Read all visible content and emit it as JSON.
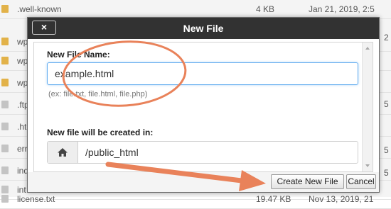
{
  "background_list": {
    "rows": [
      {
        "name": ".well-known",
        "size": "4 KB",
        "date": "Jan 21, 2019, 2:5",
        "icon": "folder-icon"
      },
      {
        "name": "wp",
        "size": "",
        "date": "",
        "icon": "folder-icon"
      },
      {
        "name": "wp",
        "size": "",
        "date": "",
        "icon": "folder-icon"
      },
      {
        "name": "wp",
        "size": "",
        "date": "",
        "icon": "folder-icon"
      },
      {
        "name": ".ftp",
        "size": "",
        "date": "",
        "icon": "file-icon"
      },
      {
        "name": ".ht",
        "size": "",
        "date": "",
        "icon": "file-icon"
      },
      {
        "name": "err",
        "size": "",
        "date": "",
        "icon": "file-icon"
      },
      {
        "name": "ind",
        "size": "",
        "date": "",
        "icon": "file-icon"
      },
      {
        "name": "int",
        "size": "",
        "date": "",
        "icon": "file-icon"
      },
      {
        "name": "license.txt",
        "size": "19.47 KB",
        "date": "Nov 13, 2019, 21",
        "icon": "file-icon"
      }
    ],
    "right_edge": [
      "2",
      "5",
      "5",
      "5"
    ]
  },
  "dialog": {
    "title": "New File",
    "close_label": "×",
    "file_name_label": "New File Name:",
    "file_name_value": "example.html",
    "file_name_hint": "(ex: file.txt, file.html, file.php)",
    "directory_label": "New file will be created in:",
    "directory_icon": "home-icon",
    "directory_value": "/public_html",
    "create_button": "Create New File",
    "cancel_button": "Cancel"
  },
  "colors": {
    "titlebar": "#323232",
    "annotation": "#e9825a",
    "input_focus": "#66aef0"
  }
}
